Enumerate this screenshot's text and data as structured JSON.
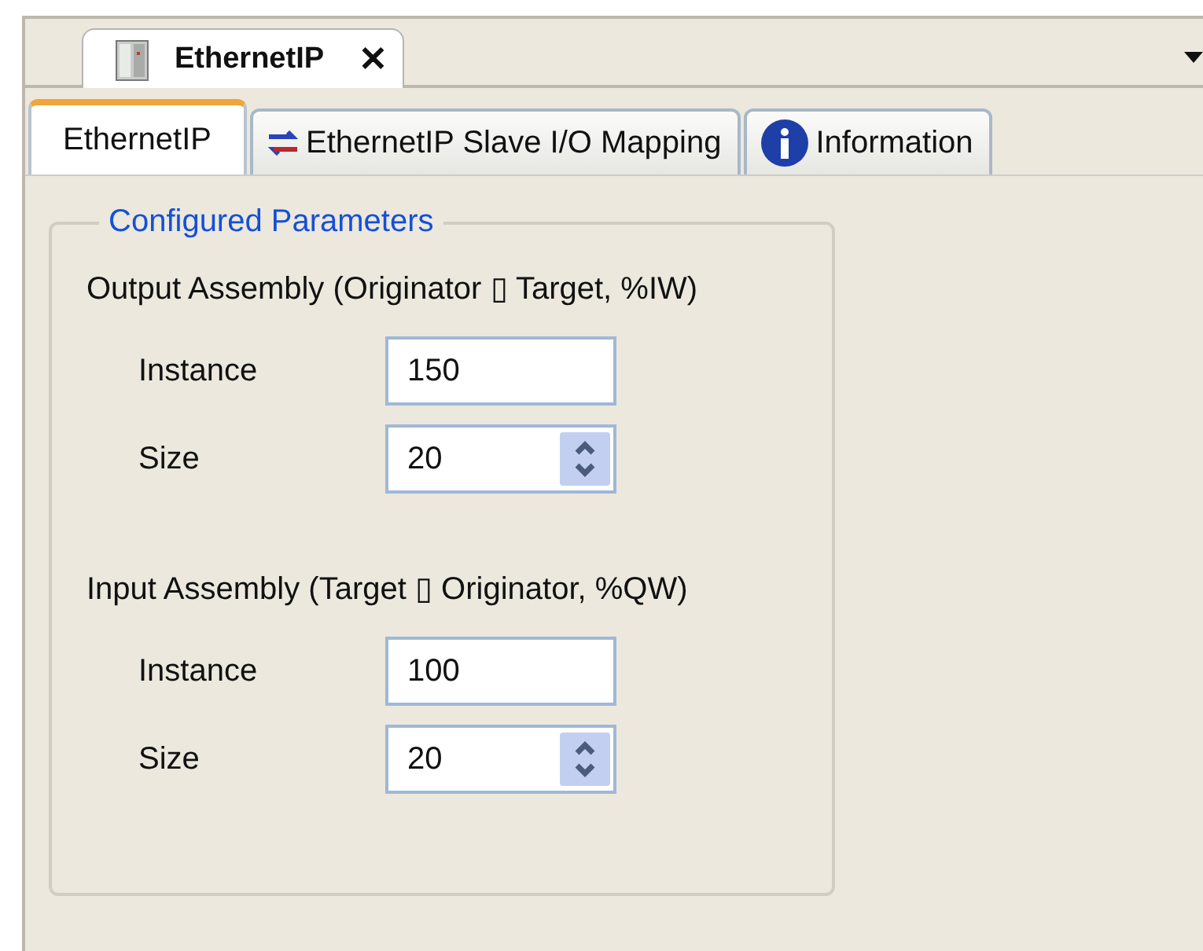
{
  "document_tab": {
    "title": "EthernetIP",
    "close": "✕"
  },
  "tabs": [
    {
      "label": "EthernetIP",
      "selected": true,
      "kind": "plain"
    },
    {
      "label": "EthernetIP Slave I/O Mapping",
      "selected": false,
      "kind": "mapping"
    },
    {
      "label": "Information",
      "selected": false,
      "kind": "info"
    }
  ],
  "group": {
    "title": "Configured Parameters",
    "sections": [
      {
        "title": "Output Assembly (Originator ▯ Target, %IW)",
        "fields": [
          {
            "label": "Instance",
            "value": "150",
            "kind": "text"
          },
          {
            "label": "Size",
            "value": "20",
            "kind": "spin"
          }
        ]
      },
      {
        "title": "Input Assembly (Target ▯ Originator, %QW)",
        "fields": [
          {
            "label": "Instance",
            "value": "100",
            "kind": "text"
          },
          {
            "label": "Size",
            "value": "20",
            "kind": "spin"
          }
        ]
      }
    ]
  }
}
